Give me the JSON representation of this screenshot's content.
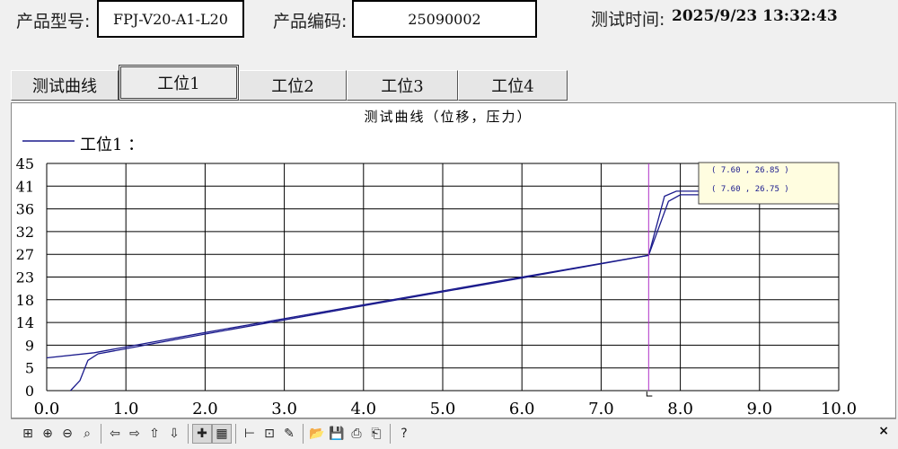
{
  "header": {
    "model_label": "产品型号:",
    "model_value": "FPJ-V20-A1-L20",
    "code_label": "产品编码:",
    "code_value": "25090002",
    "time_label": "测试时间:",
    "time_value": "2025/9/23 13:32:43"
  },
  "tabs": [
    {
      "label": "测试曲线",
      "active": false
    },
    {
      "label": "工位1",
      "active": true
    },
    {
      "label": "工位2",
      "active": false
    },
    {
      "label": "工位3",
      "active": false
    },
    {
      "label": "工位4",
      "active": false
    }
  ],
  "chart_data": {
    "type": "line",
    "title": "测试曲线（位移，压力）",
    "legend": [
      "工位1 ："
    ],
    "legend_position": "top-left",
    "grid": true,
    "xlim": [
      0,
      10
    ],
    "ylim": [
      0,
      45
    ],
    "x_ticks": [
      "0.0",
      "1.0",
      "2.0",
      "3.0",
      "4.0",
      "5.0",
      "6.0",
      "7.0",
      "8.0",
      "9.0",
      "10.0"
    ],
    "y_ticks": [
      "0",
      "5",
      "9",
      "14",
      "18",
      "23",
      "27",
      "32",
      "36",
      "41",
      "45"
    ],
    "colors": {
      "series": "#1a1a8c",
      "cursor": "#b030c8",
      "readout_bg": "#fffde0"
    },
    "series": [
      {
        "x": [
          0,
          0.6,
          2,
          4,
          6,
          7.6,
          7.8,
          7.95,
          8.5,
          9.0
        ],
        "y": [
          6.5,
          7.5,
          11.5,
          17,
          22.5,
          26.8,
          38.5,
          39.5,
          39.5,
          39.5
        ]
      },
      {
        "x": [
          0.3,
          0.42,
          0.52,
          0.65,
          2,
          4,
          6,
          7.6,
          7.85,
          8.0,
          8.5,
          9.0
        ],
        "y": [
          0,
          2,
          6,
          7.3,
          11.2,
          16.8,
          22.3,
          26.8,
          37.5,
          38.8,
          38.8,
          38.8
        ]
      }
    ],
    "cursor_x": 7.6,
    "readout": [
      "(    7.60 ,      26.85 )",
      "(    7.60 ,      26.75 )"
    ]
  },
  "toolbar": {
    "icons": [
      "zoom-box-icon",
      "zoom-in-icon",
      "zoom-out-icon",
      "zoom-reset-icon",
      "pan-left-icon",
      "pan-right-icon",
      "pan-up-icon",
      "pan-down-icon",
      "cursor-icon",
      "grid-icon",
      "axis-icon",
      "data-tip-icon",
      "settings-icon",
      "open-icon",
      "save-icon",
      "print-icon",
      "print-preview-icon",
      "help-icon"
    ],
    "glyphs": [
      "⊞",
      "⊕",
      "⊖",
      "⌕",
      "⇦",
      "⇨",
      "⇧",
      "⇩",
      "✚",
      "▦",
      "⊢",
      "⊡",
      "✎",
      "📂",
      "💾",
      "⎙",
      "⎗",
      "?"
    ],
    "close": "×"
  }
}
